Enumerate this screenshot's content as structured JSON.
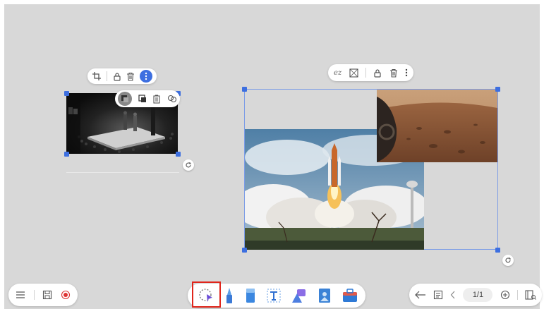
{
  "canvas": {
    "background": "#d8d8d8",
    "selection_color": "#3d6fe0"
  },
  "left_image": {
    "toolbar_icons": [
      "crop-icon",
      "lock-icon",
      "trash-icon",
      "more-icon"
    ],
    "layer_menu_icons": [
      "bring-forward-icon",
      "send-backward-icon",
      "copy-icon",
      "group-icon"
    ]
  },
  "right_group": {
    "toolbar_icons": [
      "ungroup-icon",
      "image-frame-icon",
      "lock-icon",
      "trash-icon",
      "more-icon"
    ],
    "images": [
      "mars-surface",
      "shuttle-launch"
    ]
  },
  "bottom_left": {
    "icons": [
      "menu-icon",
      "save-icon",
      "record-icon"
    ]
  },
  "bottom_center": {
    "tools": [
      "lasso-select-icon",
      "pen-icon",
      "eraser-icon",
      "text-icon",
      "shapes-icon",
      "image-icon",
      "toolbox-icon"
    ],
    "active_tool": "lasso-select-icon",
    "highlight_color": "#e0251b"
  },
  "bottom_right": {
    "page_indicator": "1/1",
    "icons": [
      "undo-icon",
      "notes-icon",
      "prev-page-icon",
      "add-page-icon",
      "pages-panel-icon"
    ]
  }
}
